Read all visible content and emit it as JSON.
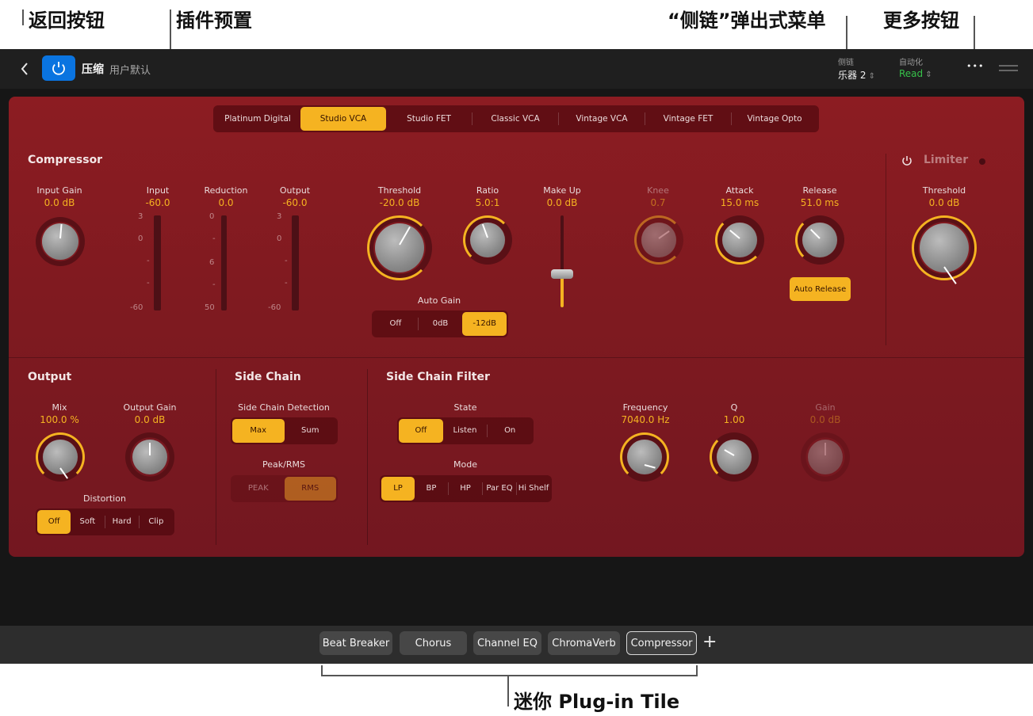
{
  "callouts": {
    "back": "返回按钮",
    "preset": "插件预置",
    "sidechain_menu": "“侧链”弹出式菜单",
    "more": "更多按钮",
    "mini_tile": "迷你 Plug-in Tile"
  },
  "header": {
    "plugin_name": "压缩",
    "preset_name": "用户默认",
    "sidechain_label": "侧链",
    "sidechain_value": "乐器 2",
    "automation_label": "自动化",
    "automation_value": "Read",
    "more_glyph": "•••"
  },
  "models": [
    {
      "label": "Platinum Digital",
      "active": false
    },
    {
      "label": "Studio VCA",
      "active": true
    },
    {
      "label": "Studio FET",
      "active": false
    },
    {
      "label": "Classic VCA",
      "active": false
    },
    {
      "label": "Vintage VCA",
      "active": false
    },
    {
      "label": "Vintage FET",
      "active": false
    },
    {
      "label": "Vintage Opto",
      "active": false
    }
  ],
  "compressor": {
    "title": "Compressor",
    "input_gain": {
      "label": "Input Gain",
      "value": "0.0 dB"
    },
    "input_meter": {
      "label": "Input",
      "value": "-60.0",
      "ticks": [
        "3",
        "0",
        "-",
        "-",
        "-60"
      ]
    },
    "reduction_meter": {
      "label": "Reduction",
      "value": "0.0",
      "ticks": [
        "0",
        "-",
        "6",
        "-",
        "50"
      ]
    },
    "output_meter": {
      "label": "Output",
      "value": "-60.0",
      "ticks": [
        "3",
        "0",
        "-",
        "-",
        "-60"
      ]
    },
    "threshold": {
      "label": "Threshold",
      "value": "-20.0 dB"
    },
    "ratio": {
      "label": "Ratio",
      "value": "5.0:1"
    },
    "makeup": {
      "label": "Make Up",
      "value": "0.0 dB"
    },
    "knee": {
      "label": "Knee",
      "value": "0.7"
    },
    "attack": {
      "label": "Attack",
      "value": "15.0 ms"
    },
    "release": {
      "label": "Release",
      "value": "51.0 ms"
    },
    "auto_release": "Auto Release",
    "auto_gain": {
      "label": "Auto Gain",
      "options": [
        "Off",
        "0dB",
        "-12dB"
      ],
      "selected": 2
    }
  },
  "limiter": {
    "title": "Limiter",
    "threshold": {
      "label": "Threshold",
      "value": "0.0 dB"
    }
  },
  "output": {
    "title": "Output",
    "mix": {
      "label": "Mix",
      "value": "100.0 %"
    },
    "output_gain": {
      "label": "Output Gain",
      "value": "0.0 dB"
    },
    "distortion": {
      "label": "Distortion",
      "options": [
        "Off",
        "Soft",
        "Hard",
        "Clip"
      ],
      "selected": 0
    }
  },
  "side_chain": {
    "title": "Side Chain",
    "detection": {
      "label": "Side Chain Detection",
      "options": [
        "Max",
        "Sum"
      ],
      "selected": 0
    },
    "peak_rms": {
      "label": "Peak/RMS",
      "options": [
        "PEAK",
        "RMS"
      ],
      "selected": 1
    }
  },
  "side_chain_filter": {
    "title": "Side Chain Filter",
    "state": {
      "label": "State",
      "options": [
        "Off",
        "Listen",
        "On"
      ],
      "selected": 0
    },
    "mode": {
      "label": "Mode",
      "options": [
        "LP",
        "BP",
        "HP",
        "Par EQ",
        "Hi Shelf"
      ],
      "selected": 0
    },
    "frequency": {
      "label": "Frequency",
      "value": "7040.0 Hz"
    },
    "q": {
      "label": "Q",
      "value": "1.00"
    },
    "gain": {
      "label": "Gain",
      "value": "0.0 dB"
    }
  },
  "tiles": {
    "items": [
      "Beat Breaker",
      "Chorus",
      "Channel EQ",
      "ChromaVerb",
      "Compressor"
    ],
    "selected": 4,
    "add_glyph": "+"
  },
  "colors": {
    "accent": "#f5b321",
    "power_blue": "#0a74e0",
    "panel_red": "#8c1c22",
    "automation_green": "#36c24a"
  }
}
